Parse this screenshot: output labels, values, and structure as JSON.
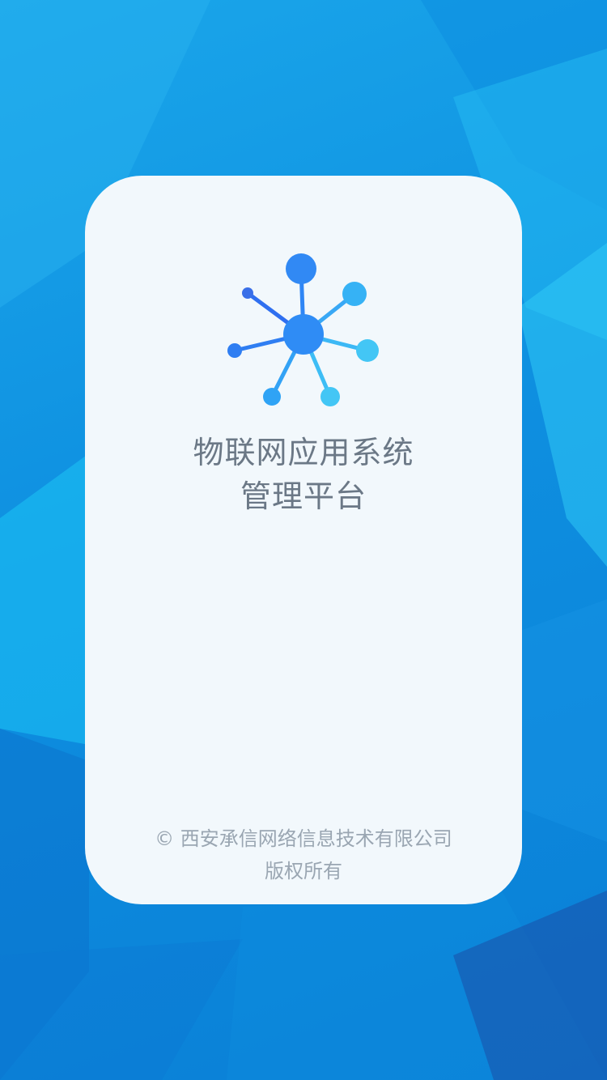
{
  "app": {
    "title_line1": "物联网应用系统",
    "title_line2": "管理平台",
    "logo_icon": "network-hub-icon"
  },
  "footer": {
    "copyright_line1": "© 西安承信网络信息技术有限公司",
    "copyright_line2": "版权所有"
  },
  "colors": {
    "background": "#0e8fe0",
    "card": "#f2f8fc",
    "title_text": "#6b7886",
    "footer_text": "#9aa6b2",
    "logo_primary": "#2f8cf5",
    "logo_light": "#43c6f5"
  }
}
